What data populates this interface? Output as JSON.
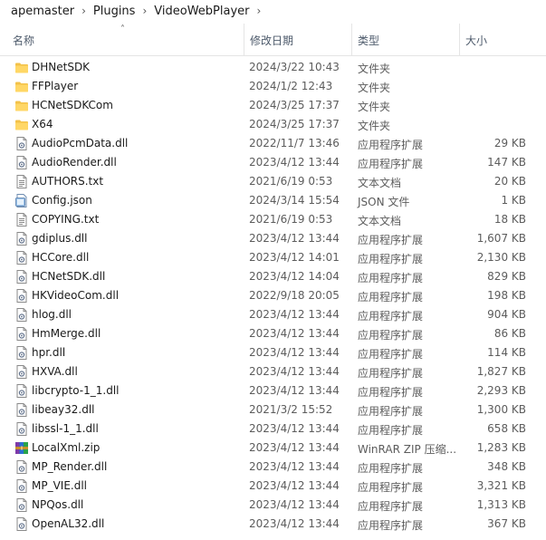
{
  "breadcrumb": [
    "apemaster",
    "Plugins",
    "VideoWebPlayer"
  ],
  "columns": {
    "name": "名称",
    "date": "修改日期",
    "type": "类型",
    "size": "大小"
  },
  "rows": [
    {
      "name": "DHNetSDK",
      "date": "2024/3/22 10:43",
      "type": "文件夹",
      "size": "",
      "icon": "folder-icon"
    },
    {
      "name": "FFPlayer",
      "date": "2024/1/2 12:43",
      "type": "文件夹",
      "size": "",
      "icon": "folder-icon"
    },
    {
      "name": "HCNetSDKCom",
      "date": "2024/3/25 17:37",
      "type": "文件夹",
      "size": "",
      "icon": "folder-icon"
    },
    {
      "name": "X64",
      "date": "2024/3/25 17:37",
      "type": "文件夹",
      "size": "",
      "icon": "folder-icon"
    },
    {
      "name": "AudioPcmData.dll",
      "date": "2022/11/7 13:46",
      "type": "应用程序扩展",
      "size": "29 KB",
      "icon": "dll-file-icon"
    },
    {
      "name": "AudioRender.dll",
      "date": "2023/4/12 13:44",
      "type": "应用程序扩展",
      "size": "147 KB",
      "icon": "dll-file-icon"
    },
    {
      "name": "AUTHORS.txt",
      "date": "2021/6/19 0:53",
      "type": "文本文档",
      "size": "20 KB",
      "icon": "text-file-icon"
    },
    {
      "name": "Config.json",
      "date": "2024/3/14 15:54",
      "type": "JSON 文件",
      "size": "1 KB",
      "icon": "json-file-icon"
    },
    {
      "name": "COPYING.txt",
      "date": "2021/6/19 0:53",
      "type": "文本文档",
      "size": "18 KB",
      "icon": "text-file-icon"
    },
    {
      "name": "gdiplus.dll",
      "date": "2023/4/12 13:44",
      "type": "应用程序扩展",
      "size": "1,607 KB",
      "icon": "dll-file-icon"
    },
    {
      "name": "HCCore.dll",
      "date": "2023/4/12 14:01",
      "type": "应用程序扩展",
      "size": "2,130 KB",
      "icon": "dll-file-icon"
    },
    {
      "name": "HCNetSDK.dll",
      "date": "2023/4/12 14:04",
      "type": "应用程序扩展",
      "size": "829 KB",
      "icon": "dll-file-icon"
    },
    {
      "name": "HKVideoCom.dll",
      "date": "2022/9/18 20:05",
      "type": "应用程序扩展",
      "size": "198 KB",
      "icon": "dll-file-icon"
    },
    {
      "name": "hlog.dll",
      "date": "2023/4/12 13:44",
      "type": "应用程序扩展",
      "size": "904 KB",
      "icon": "dll-file-icon"
    },
    {
      "name": "HmMerge.dll",
      "date": "2023/4/12 13:44",
      "type": "应用程序扩展",
      "size": "86 KB",
      "icon": "dll-file-icon"
    },
    {
      "name": "hpr.dll",
      "date": "2023/4/12 13:44",
      "type": "应用程序扩展",
      "size": "114 KB",
      "icon": "dll-file-icon"
    },
    {
      "name": "HXVA.dll",
      "date": "2023/4/12 13:44",
      "type": "应用程序扩展",
      "size": "1,827 KB",
      "icon": "dll-file-icon"
    },
    {
      "name": "libcrypto-1_1.dll",
      "date": "2023/4/12 13:44",
      "type": "应用程序扩展",
      "size": "2,293 KB",
      "icon": "dll-file-icon"
    },
    {
      "name": "libeay32.dll",
      "date": "2021/3/2 15:52",
      "type": "应用程序扩展",
      "size": "1,300 KB",
      "icon": "dll-file-icon"
    },
    {
      "name": "libssl-1_1.dll",
      "date": "2023/4/12 13:44",
      "type": "应用程序扩展",
      "size": "658 KB",
      "icon": "dll-file-icon"
    },
    {
      "name": "LocalXml.zip",
      "date": "2023/4/12 13:44",
      "type": "WinRAR ZIP 压缩...",
      "size": "1,283 KB",
      "icon": "winrar-zip-icon"
    },
    {
      "name": "MP_Render.dll",
      "date": "2023/4/12 13:44",
      "type": "应用程序扩展",
      "size": "348 KB",
      "icon": "dll-file-icon"
    },
    {
      "name": "MP_VIE.dll",
      "date": "2023/4/12 13:44",
      "type": "应用程序扩展",
      "size": "3,321 KB",
      "icon": "dll-file-icon"
    },
    {
      "name": "NPQos.dll",
      "date": "2023/4/12 13:44",
      "type": "应用程序扩展",
      "size": "1,313 KB",
      "icon": "dll-file-icon"
    },
    {
      "name": "OpenAL32.dll",
      "date": "2023/4/12 13:44",
      "type": "应用程序扩展",
      "size": "367 KB",
      "icon": "dll-file-icon"
    }
  ]
}
